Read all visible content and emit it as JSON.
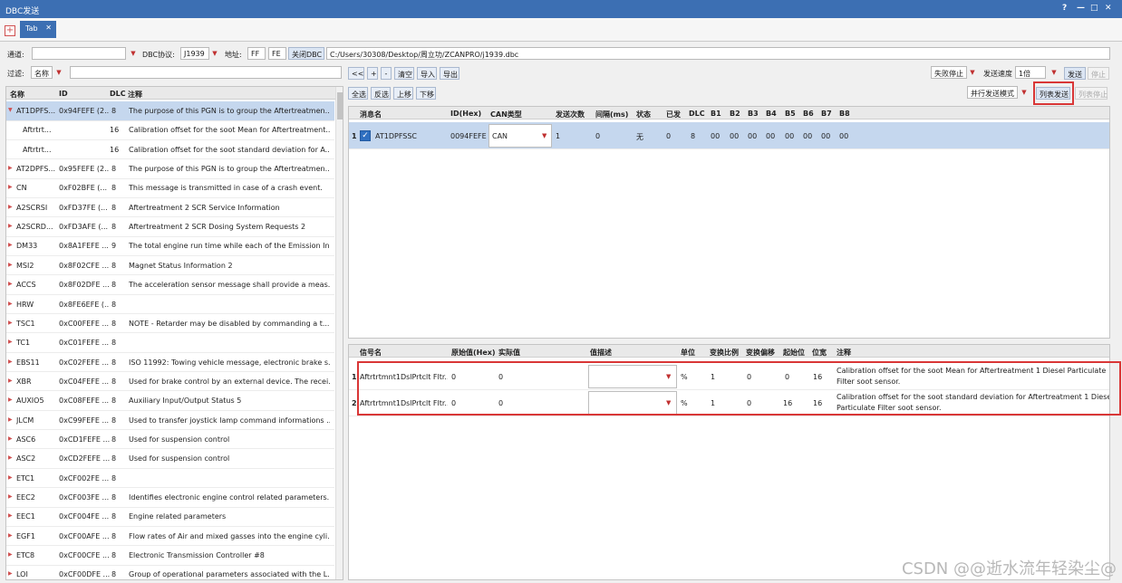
{
  "window": {
    "title": "DBC发送",
    "controls": [
      "?",
      "—",
      "□",
      "✕"
    ]
  },
  "tab": {
    "label": "Tab",
    "close": "✕",
    "add": "+"
  },
  "toolbar1": {
    "channel_label": "通道:",
    "channel_value": "",
    "dbc_protocol_label": "DBC协议:",
    "dbc_protocol_value": "J1939",
    "address_label": "地址:",
    "address_value1": "FF",
    "address_value2": "FE",
    "close_dbc_button": "关闭DBC",
    "path": "C:/Users/30308/Desktop/周立功/ZCANPRO/j1939.dbc"
  },
  "toolbar2": {
    "filter_label": "过滤:",
    "filter_field": "名称",
    "filter_value": "",
    "buttons": [
      "<<",
      "+",
      "-",
      "清空",
      "导入",
      "导出"
    ],
    "fail_stop": "失败停止",
    "send_speed_label": "发送速度",
    "send_speed_value": "1倍",
    "send_button": "发送",
    "stop_button": "停止"
  },
  "toolbar3": {
    "buttons": [
      "全选",
      "反选",
      "上移",
      "下移"
    ],
    "mode_value": "并行发送模式",
    "list_send_button": "列表发送",
    "list_stop_button": "列表停止"
  },
  "left_table": {
    "headers": [
      "名称",
      "ID",
      "DLC",
      "注释"
    ],
    "rows": [
      {
        "name": "AT1DPFS...",
        "id": "0x94FEFE (2...",
        "dlc": "8",
        "comment": "The purpose of this PGN is to group the Aftertreatmen...",
        "arrow": true,
        "selected": true
      },
      {
        "name": "Aftrtrt...",
        "id": "",
        "dlc": "16",
        "comment": "Calibration offset for the soot Mean for Aftertreatment...",
        "arrow": false,
        "child": true
      },
      {
        "name": "Aftrtrt...",
        "id": "",
        "dlc": "16",
        "comment": "Calibration offset for the soot standard deviation for A...",
        "arrow": false,
        "child": true
      },
      {
        "name": "AT2DPFS...",
        "id": "0x95FEFE (2...",
        "dlc": "8",
        "comment": "The purpose of this PGN is to group the Aftertreatmen...",
        "arrow": true
      },
      {
        "name": "CN",
        "id": "0xF02BFE (...",
        "dlc": "8",
        "comment": "This message is transmitted in case of a crash event.",
        "arrow": true
      },
      {
        "name": "A2SCRSI",
        "id": "0xFD37FE (...",
        "dlc": "8",
        "comment": "Aftertreatment 2 SCR Service Information",
        "arrow": true
      },
      {
        "name": "A2SCRD...",
        "id": "0xFD3AFE (...",
        "dlc": "8",
        "comment": "Aftertreatment 2 SCR Dosing System Requests 2",
        "arrow": true
      },
      {
        "name": "DM33",
        "id": "0x8A1FEFE ...",
        "dlc": "9",
        "comment": "The total engine run time while each of the Emission In...",
        "arrow": true
      },
      {
        "name": "MSI2",
        "id": "0x8F02CFE ...",
        "dlc": "8",
        "comment": "Magnet Status Information 2",
        "arrow": true
      },
      {
        "name": "ACCS",
        "id": "0x8F02DFE ...",
        "dlc": "8",
        "comment": "The acceleration sensor message shall provide a meas...",
        "arrow": true
      },
      {
        "name": "HRW",
        "id": "0x8FE6EFE (...",
        "dlc": "8",
        "comment": "",
        "arrow": true
      },
      {
        "name": "TSC1",
        "id": "0xC00FEFE ...",
        "dlc": "8",
        "comment": "NOTE - Retarder may be disabled by commanding a t...",
        "arrow": true
      },
      {
        "name": "TC1",
        "id": "0xC01FEFE ...",
        "dlc": "8",
        "comment": "",
        "arrow": true
      },
      {
        "name": "EBS11",
        "id": "0xC02FEFE ...",
        "dlc": "8",
        "comment": "ISO 11992: Towing vehicle message, electronic brake s...",
        "arrow": true
      },
      {
        "name": "XBR",
        "id": "0xC04FEFE ...",
        "dlc": "8",
        "comment": "Used for brake control by an external device. The recei...",
        "arrow": true
      },
      {
        "name": "AUXIO5",
        "id": "0xC08FEFE ...",
        "dlc": "8",
        "comment": "Auxiliary Input/Output Status 5",
        "arrow": true
      },
      {
        "name": "JLCM",
        "id": "0xC99FEFE ...",
        "dlc": "8",
        "comment": "Used to transfer joystick lamp command informations ...",
        "arrow": true
      },
      {
        "name": "ASC6",
        "id": "0xCD1FEFE ...",
        "dlc": "8",
        "comment": "Used for suspension control",
        "arrow": true
      },
      {
        "name": "ASC2",
        "id": "0xCD2FEFE ...",
        "dlc": "8",
        "comment": "Used for suspension control",
        "arrow": true
      },
      {
        "name": "ETC1",
        "id": "0xCF002FE ...",
        "dlc": "8",
        "comment": "",
        "arrow": true
      },
      {
        "name": "EEC2",
        "id": "0xCF003FE ...",
        "dlc": "8",
        "comment": "Identifies electronic engine control related parameters.",
        "arrow": true
      },
      {
        "name": "EEC1",
        "id": "0xCF004FE ...",
        "dlc": "8",
        "comment": "Engine related parameters",
        "arrow": true
      },
      {
        "name": "EGF1",
        "id": "0xCF00AFE ...",
        "dlc": "8",
        "comment": "Flow rates of Air and mixed gasses into the engine cyli...",
        "arrow": true
      },
      {
        "name": "ETC8",
        "id": "0xCF00CFE ...",
        "dlc": "8",
        "comment": "Electronic Transmission Controller #8",
        "arrow": true
      },
      {
        "name": "LOI",
        "id": "0xCF00DFE ...",
        "dlc": "8",
        "comment": "Group of operational parameters associated with the L...",
        "arrow": true
      }
    ]
  },
  "msg_table": {
    "headers": [
      "消息名",
      "ID(Hex)",
      "CAN类型",
      "发送次数",
      "间隔(ms)",
      "状态",
      "已发",
      "DLC",
      "B1",
      "B2",
      "B3",
      "B4",
      "B5",
      "B6",
      "B7",
      "B8"
    ],
    "rows": [
      {
        "index": "1",
        "name": "AT1DPFSSC",
        "id": "0094FEFE",
        "can_type": "CAN",
        "count": "1",
        "interval": "0",
        "status": "无",
        "sent": "0",
        "dlc": "8",
        "bytes": [
          "00",
          "00",
          "00",
          "00",
          "00",
          "00",
          "00",
          "00"
        ]
      }
    ]
  },
  "sig_table": {
    "headers": [
      "信号名",
      "原始值(Hex)",
      "实际值",
      "值描述",
      "单位",
      "变换比例",
      "变换偏移",
      "起始位",
      "位宽",
      "注释"
    ],
    "rows": [
      {
        "index": "1",
        "name": "Aftrtrtmnt1DslPrtclt Fltr...",
        "raw": "0",
        "actual": "0",
        "desc": "",
        "unit": "%",
        "factor": "1",
        "offset": "0",
        "start": "0",
        "width": "16",
        "comment1": "Calibration offset for the soot Mean for Aftertreatment 1 Diesel Particulate",
        "comment2": "Filter soot sensor."
      },
      {
        "index": "2",
        "name": "Aftrtrtmnt1DslPrtclt Fltr...",
        "raw": "0",
        "actual": "0",
        "desc": "",
        "unit": "%",
        "factor": "1",
        "offset": "0",
        "start": "16",
        "width": "16",
        "comment1": "Calibration offset for the soot standard deviation for Aftertreatment 1 Diesel",
        "comment2": "Particulate Filter soot sensor."
      }
    ]
  },
  "watermark": "CSDN @@逝水流年轻染尘@",
  "colors": {
    "accent": "#3c6fb3",
    "selection": "#c5d7ee",
    "highlight": "#d93636"
  }
}
